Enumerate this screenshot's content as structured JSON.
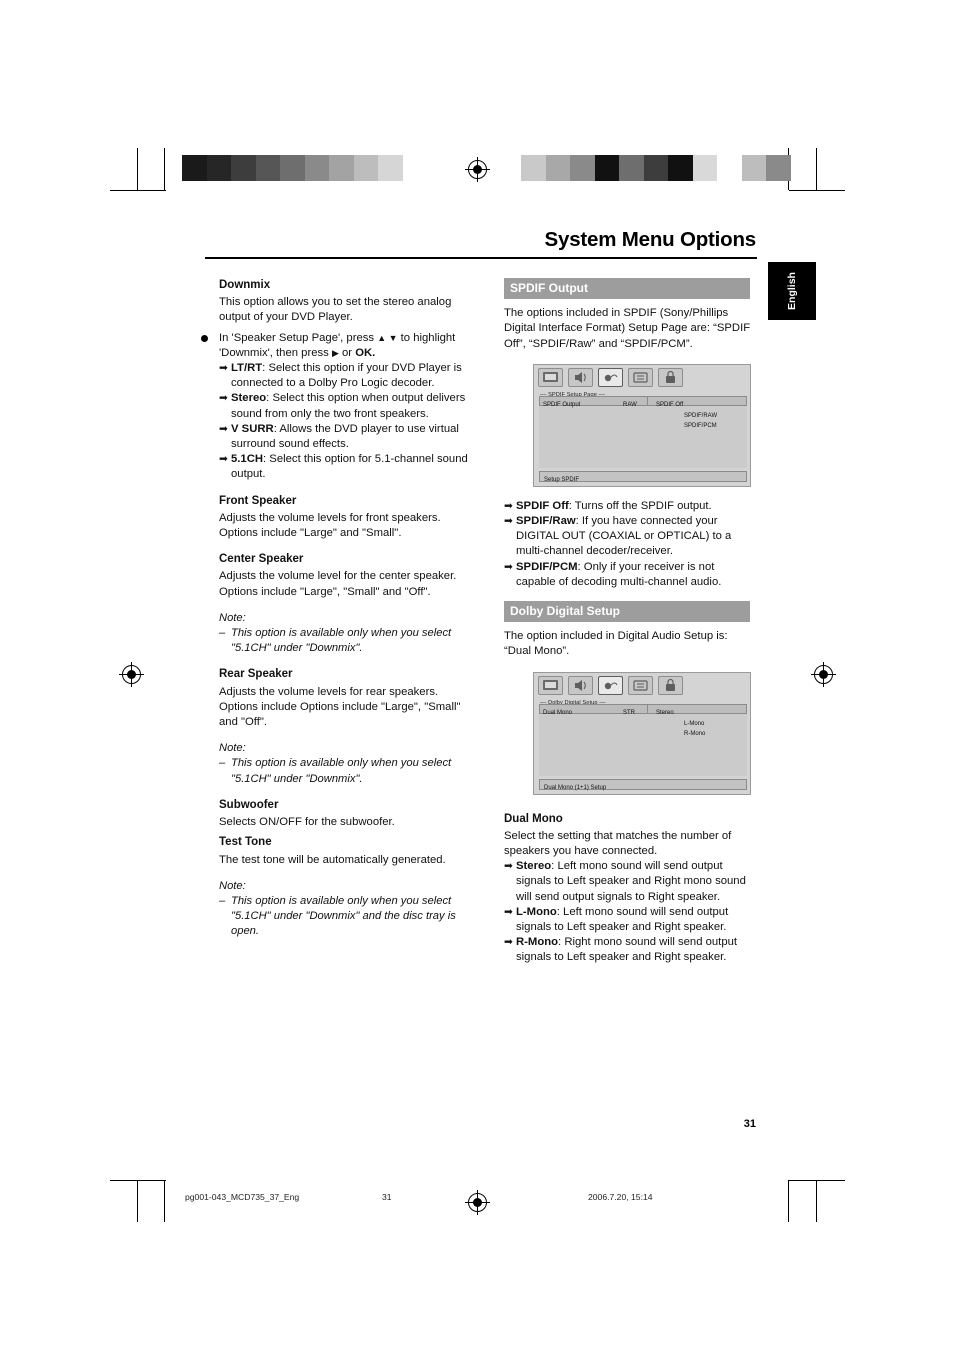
{
  "header": {
    "title": "System Menu Options",
    "language_tab": "English"
  },
  "left_column": {
    "downmix": {
      "heading": "Downmix",
      "intro": "This option allows you to set the stereo analog output of your DVD Player.",
      "bullet": "In 'Speaker Setup Page', press ▲ ▼ to highlight 'Downmix', then press ▶ or OK.",
      "bullet_bold_1": "OK",
      "options": [
        {
          "term": "LT/RT",
          "desc": ": Select this option if your DVD Player is connected to a Dolby Pro Logic decoder."
        },
        {
          "term": "Stereo",
          "desc": ": Select this option when output delivers sound from only the two front speakers."
        },
        {
          "term": "V SURR",
          "desc": ": Allows the DVD player to use virtual surround sound effects."
        },
        {
          "term": "5.1CH",
          "desc": ": Select this option for 5.1-channel sound output."
        }
      ]
    },
    "front_speaker": {
      "heading": "Front Speaker",
      "body": "Adjusts the volume levels for front speakers. Options include \"Large\" and \"Small\"."
    },
    "center_speaker": {
      "heading": "Center Speaker",
      "body": "Adjusts the volume level for the center speaker. Options include \"Large\", \"Small\" and \"Off\"."
    },
    "note_1": {
      "label": "Note:",
      "dash": "–",
      "text": "This option is available only when you select \"5.1CH\" under \"Downmix\"."
    },
    "rear_speaker": {
      "heading": "Rear Speaker",
      "body": "Adjusts the volume levels for rear speakers. Options include Options include \"Large\", \"Small\" and \"Off\"."
    },
    "note_2": {
      "label": "Note:",
      "dash": "–",
      "text": "This option is available only when you select \"5.1CH\" under \"Downmix\"."
    },
    "subwoofer": {
      "heading": "Subwoofer",
      "body": "Selects ON/OFF for the subwoofer."
    },
    "test_tone": {
      "heading": "Test Tone",
      "body": "The test tone will be automatically generated."
    },
    "note_3": {
      "label": "Note:",
      "dash": "–",
      "text": "This option is available only when you select \"5.1CH\" under \"Downmix\" and the disc tray is open."
    }
  },
  "right_column": {
    "spdif": {
      "bar_title": "SPDIF Output",
      "intro": "The options included in SPDIF (Sony/Phillips Digital Interface Format) Setup Page are: “SPDIF Off”, “SPDIF/Raw” and “SPDIF/PCM”.",
      "osd": {
        "page_label": "–– SPDIF Setup Page ––",
        "row_label": "SPDIF Output",
        "row_value": "RAW",
        "row_selected": "SPDIF Off",
        "options": [
          "SPDIF/RAW",
          "SPDIF/PCM"
        ],
        "footer": "Setup SPDIF"
      },
      "options": [
        {
          "term": "SPDIF Off",
          "desc": ": Turns off the SPDIF output."
        },
        {
          "term": "SPDIF/Raw",
          "desc": ": If you have connected your DIGITAL OUT (COAXIAL or OPTICAL) to a multi-channel decoder/receiver."
        },
        {
          "term": "SPDIF/PCM",
          "desc": ": Only if your receiver is not capable of decoding multi-channel audio."
        }
      ]
    },
    "dolby": {
      "bar_title": "Dolby Digital Setup",
      "intro": "The option included in Digital Audio Setup is: “Dual Mono”.",
      "osd": {
        "page_label": "–– Dolby Digital Setup ––",
        "row_label": "Dual Mono",
        "row_value": "STR",
        "row_selected": "Stereo",
        "options": [
          "L-Mono",
          "R-Mono"
        ],
        "footer": "Dual Mono (1+1) Setup"
      }
    },
    "dual_mono": {
      "heading": "Dual Mono",
      "body": "Select the setting that matches the number of speakers you have connected.",
      "options": [
        {
          "term": "Stereo",
          "desc": ": Left mono sound will send output signals to Left speaker and Right mono sound will send output signals to Right speaker."
        },
        {
          "term": "L-Mono",
          "desc": ": Left mono sound will send output signals to Left speaker and Right speaker."
        },
        {
          "term": "R-Mono",
          "desc": ": Right mono sound will send output signals to Left speaker and Right speaker."
        }
      ]
    }
  },
  "footer": {
    "page_number": "31",
    "file_name": "pg001-043_MCD735_37_Eng",
    "page_mark": "31",
    "timestamp": "2006.7.20, 15:14"
  },
  "swatches": {
    "left": [
      "#1a1a1a",
      "#262626",
      "#3d3d3d",
      "#565656",
      "#6e6e6e",
      "#8a8a8a",
      "#a3a3a3",
      "#bdbdbd",
      "#d6d6d6",
      "#ffffff"
    ],
    "right": [
      "#c9c9c9",
      "#a8a8a8",
      "#8a8a8a",
      "#111111",
      "#6e6e6e",
      "#3d3d3d",
      "#111111",
      "#d9d9d9",
      "#ffffff",
      "#bdbdbd",
      "#8a8a8a"
    ]
  }
}
